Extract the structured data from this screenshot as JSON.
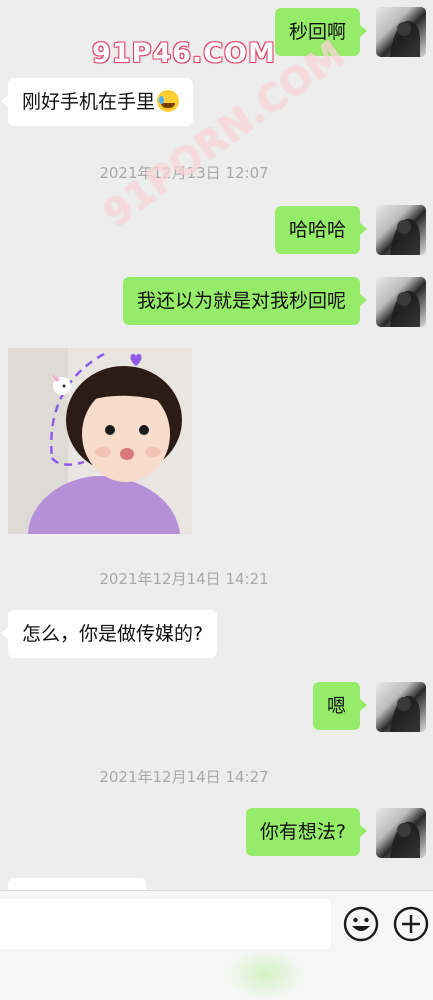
{
  "messages": [
    {
      "side": "out",
      "text": "秒回啊"
    },
    {
      "side": "in",
      "text": "刚好手机在手里"
    },
    {
      "time": "2021年12月13日 12:07"
    },
    {
      "side": "out",
      "text": "哈哈哈"
    },
    {
      "side": "out",
      "text": "我还以为就是对我秒回呢"
    },
    {
      "side": "in",
      "type": "sticker"
    },
    {
      "time": "2021年12月14日 14:21"
    },
    {
      "side": "in",
      "text": "怎么，你是做传媒的?"
    },
    {
      "side": "out",
      "text": "嗯"
    },
    {
      "time": "2021年12月14日 14:27"
    },
    {
      "side": "out",
      "text": "你有想法?"
    }
  ],
  "watermarks": [
    "91P46.COM",
    "91PORN.COM"
  ],
  "composer": {
    "placeholder": "",
    "emoji_icon": "smiley-face-icon",
    "more_icon": "plus-circle-icon"
  },
  "colors": {
    "background": "#ededed",
    "outgoing_bubble": "#95ec69",
    "incoming_bubble": "#ffffff",
    "timestamp": "#a9a9a9"
  }
}
